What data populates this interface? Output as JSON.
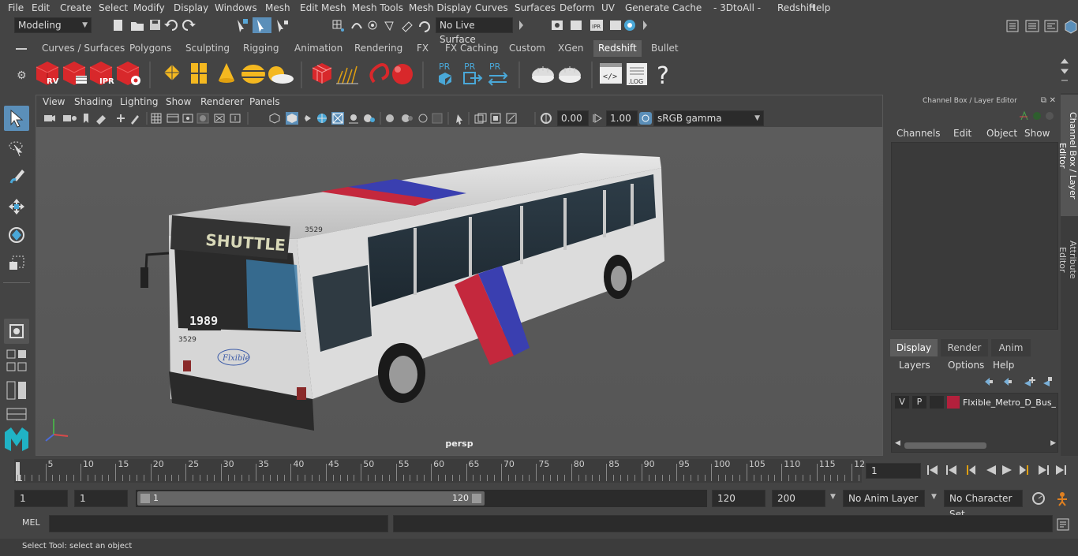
{
  "menubar": {
    "items": [
      "File",
      "Edit",
      "Create",
      "Select",
      "Modify",
      "Display",
      "Windows",
      "Mesh",
      "Edit Mesh",
      "Mesh Tools",
      "Mesh Display",
      "Curves",
      "Surfaces",
      "Deform",
      "UV",
      "Generate",
      "Cache",
      "- 3DtoAll -",
      "Redshift",
      "Help"
    ]
  },
  "statusline": {
    "mode": "Modeling",
    "live_surface": "No Live Surface"
  },
  "shelf": {
    "tabs": [
      "Curves / Surfaces",
      "Polygons",
      "Sculpting",
      "Rigging",
      "Animation",
      "Rendering",
      "FX",
      "FX Caching",
      "Custom",
      "XGen",
      "Redshift",
      "Bullet"
    ],
    "active_tab": "Redshift",
    "icon_labels": {
      "rv": "RV",
      "ipr": "IPR",
      "pr1": "PR",
      "pr2": "PR",
      "pr3": "PR",
      "log": ".LOG",
      "help": "?"
    }
  },
  "panel": {
    "menus": [
      "View",
      "Shading",
      "Lighting",
      "Show",
      "Renderer",
      "Panels"
    ],
    "exposure": "0.00",
    "gamma": "1.00",
    "colorspace": "sRGB gamma",
    "camera": "persp"
  },
  "bus": {
    "fleet_number": "3529",
    "route_sign": "SHUTTLE",
    "front_number": "1989",
    "front_badge": "3529",
    "brand": "Flxible"
  },
  "channelbox": {
    "title": "Channel Box / Layer Editor",
    "menus": [
      "Channels",
      "Edit",
      "Object",
      "Show"
    ]
  },
  "layers": {
    "tabs": [
      "Display",
      "Render",
      "Anim"
    ],
    "active_tab": "Display",
    "menus": [
      "Layers",
      "Options",
      "Help"
    ],
    "layer": {
      "v": "V",
      "p": "P",
      "name": "Flxible_Metro_D_Bus_S",
      "color": "#b3203c"
    }
  },
  "sidetabs": {
    "channel": "Channel Box / Layer Editor",
    "attribute": "Attribute Editor"
  },
  "timeslider": {
    "ticks": [
      "5",
      "10",
      "15",
      "20",
      "25",
      "30",
      "35",
      "40",
      "45",
      "50",
      "55",
      "60",
      "65",
      "70",
      "75",
      "80",
      "85",
      "90",
      "95",
      "100",
      "105",
      "110",
      "115",
      "12"
    ],
    "start_label": "1",
    "current_frame": "1"
  },
  "range": {
    "start": "1",
    "playback_start": "1",
    "slider_start": "1",
    "slider_end": "120",
    "playback_end": "120",
    "end": "200",
    "anim_layer": "No Anim Layer",
    "character_set": "No Character Set"
  },
  "cmdline": {
    "label": "MEL"
  },
  "help": {
    "text": "Select Tool: select an object"
  }
}
